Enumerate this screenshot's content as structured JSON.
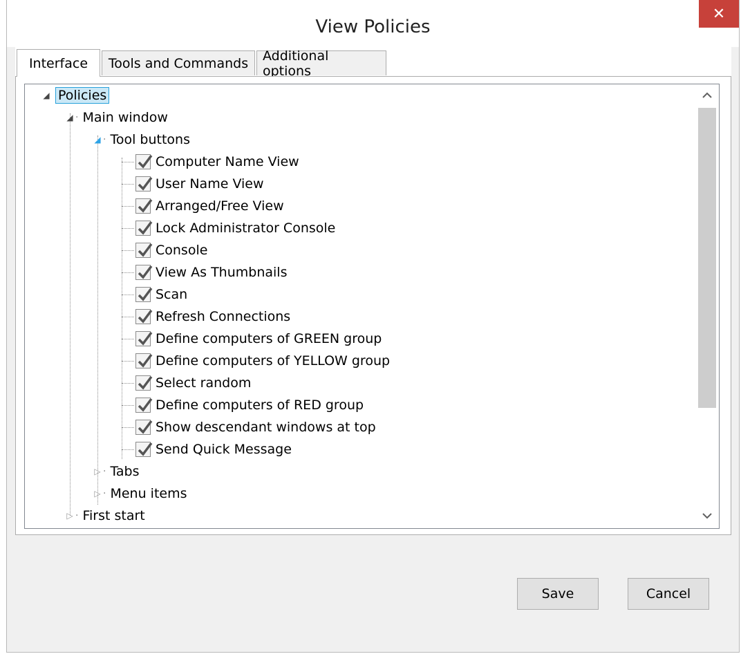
{
  "window": {
    "title": "View Policies",
    "close_glyph": "✕"
  },
  "tabs": [
    {
      "label": "Interface",
      "active": true
    },
    {
      "label": "Tools and Commands",
      "active": false
    },
    {
      "label": "Additional options",
      "active": false
    }
  ],
  "tree": {
    "root": "Policies",
    "main_window": "Main window",
    "tool_buttons": "Tool buttons",
    "items": [
      {
        "label": "Computer Name View",
        "checked": true
      },
      {
        "label": "User Name View",
        "checked": true
      },
      {
        "label": "Arranged/Free View",
        "checked": true
      },
      {
        "label": "Lock Administrator Console",
        "checked": true
      },
      {
        "label": "Console",
        "checked": true
      },
      {
        "label": "View As Thumbnails",
        "checked": true
      },
      {
        "label": "Scan",
        "checked": true
      },
      {
        "label": "Refresh Connections",
        "checked": true
      },
      {
        "label": "Define computers of GREEN group",
        "checked": true
      },
      {
        "label": "Define computers of YELLOW group",
        "checked": true
      },
      {
        "label": "Select random",
        "checked": true
      },
      {
        "label": "Define computers of RED group",
        "checked": true
      },
      {
        "label": "Show descendant windows at top",
        "checked": true
      },
      {
        "label": "Send Quick Message",
        "checked": true
      }
    ],
    "tabs_node": "Tabs",
    "menu_items_node": "Menu items",
    "first_start_node": "First start"
  },
  "buttons": {
    "save": "Save",
    "cancel": "Cancel"
  },
  "colors": {
    "accent": "#26a0da",
    "close_bg": "#c7413a"
  }
}
